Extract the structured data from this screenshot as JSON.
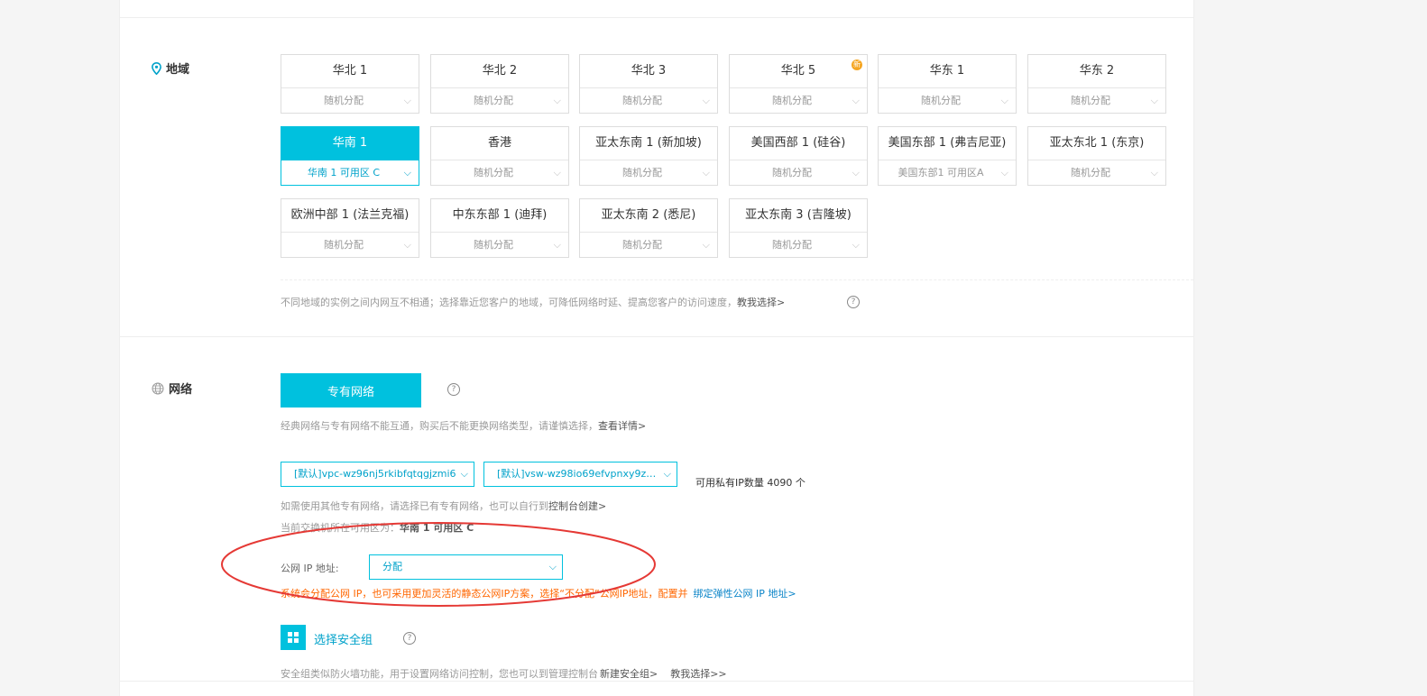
{
  "region": {
    "label": "地域",
    "cards": [
      {
        "name": "华北 1",
        "zone": "随机分配",
        "selected": false,
        "badge": false
      },
      {
        "name": "华北 2",
        "zone": "随机分配",
        "selected": false,
        "badge": false
      },
      {
        "name": "华北 3",
        "zone": "随机分配",
        "selected": false,
        "badge": false
      },
      {
        "name": "华北 5",
        "zone": "随机分配",
        "selected": false,
        "badge": true
      },
      {
        "name": "华东 1",
        "zone": "随机分配",
        "selected": false,
        "badge": false
      },
      {
        "name": "华东 2",
        "zone": "随机分配",
        "selected": false,
        "badge": false
      },
      {
        "name": "华南 1",
        "zone": "华南 1 可用区 C",
        "selected": true,
        "badge": false
      },
      {
        "name": "香港",
        "zone": "随机分配",
        "selected": false,
        "badge": false
      },
      {
        "name": "亚太东南 1 (新加坡)",
        "zone": "随机分配",
        "selected": false,
        "badge": false
      },
      {
        "name": "美国西部 1 (硅谷)",
        "zone": "随机分配",
        "selected": false,
        "badge": false
      },
      {
        "name": "美国东部 1 (弗吉尼亚)",
        "zone": "美国东部1 可用区A",
        "selected": false,
        "badge": false
      },
      {
        "name": "亚太东北 1 (东京)",
        "zone": "随机分配",
        "selected": false,
        "badge": false
      },
      {
        "name": "欧洲中部 1 (法兰克福)",
        "zone": "随机分配",
        "selected": false,
        "badge": false
      },
      {
        "name": "中东东部 1 (迪拜)",
        "zone": "随机分配",
        "selected": false,
        "badge": false
      },
      {
        "name": "亚太东南 2 (悉尼)",
        "zone": "随机分配",
        "selected": false,
        "badge": false
      },
      {
        "name": "亚太东南 3 (吉隆坡)",
        "zone": "随机分配",
        "selected": false,
        "badge": false
      }
    ],
    "note": "不同地域的实例之间内网互不相通；选择靠近您客户的地域，可降低网络时延、提高您客户的访问速度，",
    "note_link": "教我选择>"
  },
  "network": {
    "label": "网络",
    "vpc_button": "专有网络",
    "note": "经典网络与专有网络不能互通，购买后不能更换网络类型，请谨慎选择，",
    "note_link": "查看详情>",
    "vpc_select": "[默认]vpc-wz96nj5rkibfqtqgjzmi6",
    "vswitch_select": "[默认]vsw-wz98io69efvpnxy9ze...",
    "ip_count": "可用私有IP数量 4090 个",
    "create_note": "如需使用其他专有网络，请选择已有专有网络，也可以自行到",
    "create_link": "控制台创建>",
    "zone_note": "当前交换机所在可用区为：",
    "zone_value": "华南 1 可用区 C",
    "public_ip_label": "公网 IP 地址:",
    "public_ip_value": "分配",
    "warning": "系统会分配公网 IP，也可采用更加灵活的静态公网IP方案，选择“不分配”公网IP地址，配置并",
    "warning_link": "绑定弹性公网 IP 地址>",
    "sg_title": "选择安全组",
    "sg_note": "安全组类似防火墙功能，用于设置网络访问控制，您也可以到管理控制台",
    "sg_link1": "新建安全组>",
    "sg_link2": "教我选择>>"
  },
  "icons": {
    "location": "location-pin-icon",
    "globe": "globe-icon",
    "help": "help-icon",
    "chevron": "chevron-down-icon",
    "grid": "grid-icon"
  },
  "colors": {
    "accent": "#00c1de",
    "warning": "#ff6600",
    "annotation": "#e53935"
  }
}
